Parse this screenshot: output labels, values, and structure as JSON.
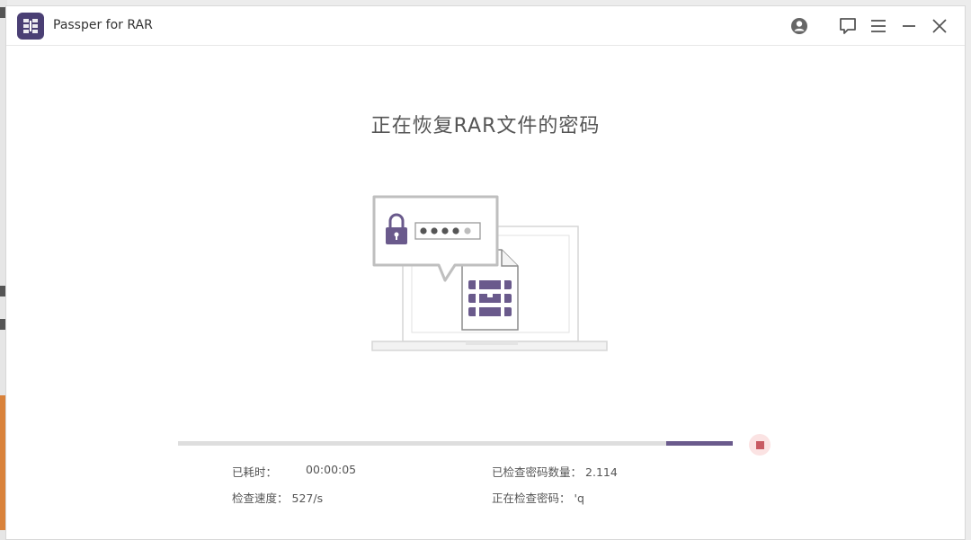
{
  "app": {
    "title": "Passper for RAR"
  },
  "titlebar": {
    "buttons": [
      "account-icon",
      "feedback-icon",
      "menu-icon",
      "minimize-icon",
      "close-icon"
    ]
  },
  "main": {
    "heading": "正在恢复RAR文件的密码"
  },
  "progress": {
    "start": 0.88,
    "end": 1.0,
    "stop_icon": "stop-icon"
  },
  "stats": {
    "elapsed_label": "已耗时：",
    "elapsed_value": "00:00:05",
    "checked_label": "已检查密码数量：",
    "checked_value": "2.114",
    "speed_label": "检查速度：",
    "speed_value": "527/s",
    "current_label": "正在检查密码：",
    "current_value": "'q"
  },
  "colors": {
    "brand": "#4a3f74",
    "progress": "#6a5a8c",
    "stop": "#c85a62"
  }
}
